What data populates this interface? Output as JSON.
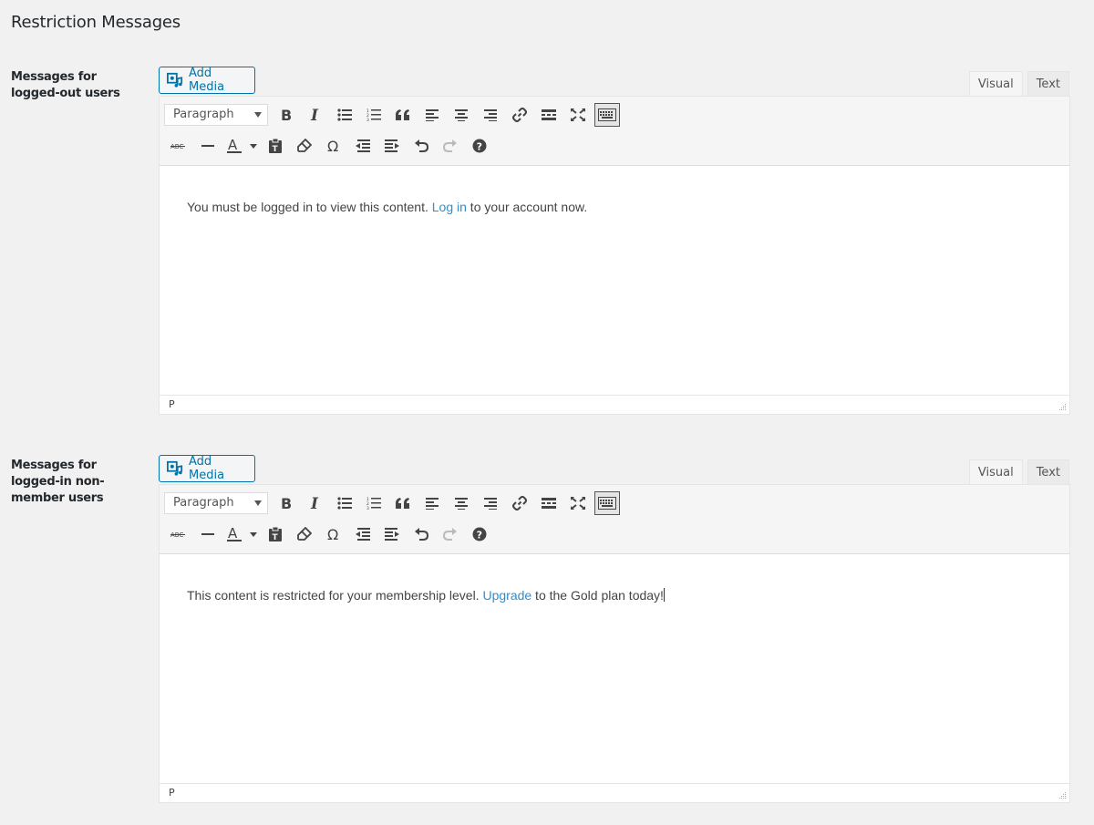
{
  "page_title": "Restriction Messages",
  "sections": [
    {
      "label": "Messages for logged-out users",
      "add_media": "Add Media",
      "tabs": [
        "Visual",
        "Text"
      ],
      "active_tab": "Visual",
      "format": "Paragraph",
      "content": {
        "before": "You must be logged in to view this content. ",
        "link": "Log in",
        "after": " to your account now."
      },
      "status_path": "P"
    },
    {
      "label": "Messages for logged-in non-member users",
      "add_media": "Add Media",
      "tabs": [
        "Visual",
        "Text"
      ],
      "active_tab": "Visual",
      "format": "Paragraph",
      "content": {
        "before": "This content is restricted for your membership level. ",
        "link": "Upgrade",
        "after": " to the Gold plan today!"
      },
      "status_path": "P"
    }
  ],
  "toolbar_icons": {
    "row1": [
      "bold-icon",
      "italic-icon",
      "bullet-list-icon",
      "numbered-list-icon",
      "blockquote-icon",
      "align-left-icon",
      "align-center-icon",
      "align-right-icon",
      "link-icon",
      "read-more-icon",
      "fullscreen-icon",
      "toolbar-toggle-icon"
    ],
    "row2": [
      "strikethrough-icon",
      "horizontal-line-icon",
      "text-color-icon",
      "paste-as-text-icon",
      "clear-formatting-icon",
      "special-character-icon",
      "outdent-icon",
      "indent-icon",
      "undo-icon",
      "redo-icon",
      "help-icon"
    ]
  },
  "colors": {
    "background": "#f1f1f1",
    "accent": "#0073aa",
    "link": "#2e8fd1"
  }
}
